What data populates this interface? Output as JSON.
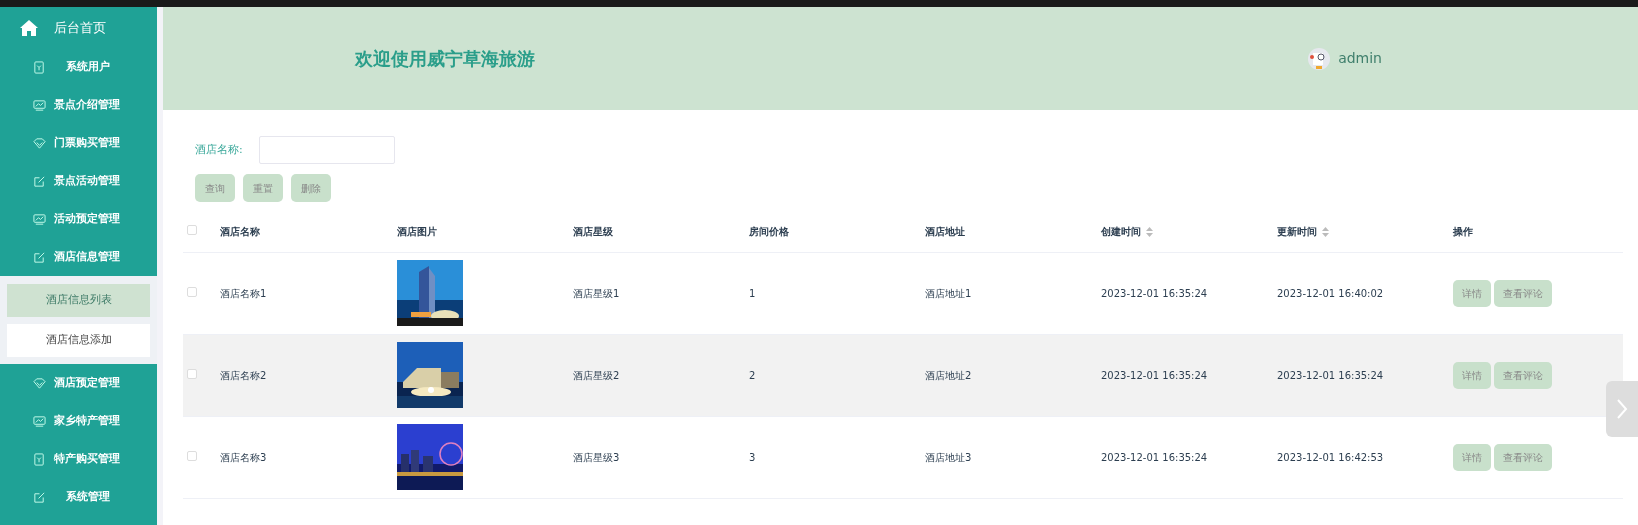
{
  "sidebar": {
    "home": "后台首页",
    "items": [
      {
        "label": "系统用户"
      },
      {
        "label": "景点介绍管理"
      },
      {
        "label": "门票购买管理"
      },
      {
        "label": "景点活动管理"
      },
      {
        "label": "活动预定管理"
      },
      {
        "label": "酒店信息管理",
        "children": [
          {
            "label": "酒店信息列表",
            "selected": true
          },
          {
            "label": "酒店信息添加",
            "selected": false
          }
        ]
      },
      {
        "label": "酒店预定管理"
      },
      {
        "label": "家乡特产管理"
      },
      {
        "label": "特产购买管理"
      },
      {
        "label": "系统管理"
      }
    ]
  },
  "header": {
    "title": "欢迎使用威宁草海旅游",
    "user": "admin"
  },
  "search": {
    "label": "酒店名称:"
  },
  "buttons": [
    "查询",
    "重置",
    "删除"
  ],
  "table": {
    "select_all": false,
    "columns": [
      {
        "label": "酒店名称",
        "sortable": false
      },
      {
        "label": "酒店图片",
        "sortable": false
      },
      {
        "label": "酒店星级",
        "sortable": false
      },
      {
        "label": "房间价格",
        "sortable": false
      },
      {
        "label": "酒店地址",
        "sortable": false
      },
      {
        "label": "创建时间",
        "sortable": true
      },
      {
        "label": "更新时间",
        "sortable": true
      },
      {
        "label": "操作",
        "sortable": false
      }
    ],
    "rows": [
      {
        "checked": false,
        "highlighted": false,
        "name": "酒店名称1",
        "picture": {
          "kind": "picture"
        },
        "stars": "酒店星级1",
        "price": "1",
        "address": "酒店地址1",
        "created": "2023-12-01 16:35:24",
        "updated": "2023-12-01 16:40:02",
        "actions": [
          "详情",
          "查看评论"
        ]
      },
      {
        "checked": false,
        "highlighted": true,
        "name": "酒店名称2",
        "picture": {
          "kind": "picture"
        },
        "stars": "酒店星级2",
        "price": "2",
        "address": "酒店地址2",
        "created": "2023-12-01 16:35:24",
        "updated": "2023-12-01 16:35:24",
        "actions": [
          "详情",
          "查看评论"
        ]
      },
      {
        "checked": false,
        "highlighted": false,
        "name": "酒店名称3",
        "picture": {
          "kind": "picture"
        },
        "stars": "酒店星级3",
        "price": "3",
        "address": "酒店地址3",
        "created": "2023-12-01 16:35:24",
        "updated": "2023-12-01 16:42:53",
        "actions": [
          "详情",
          "查看评论"
        ]
      }
    ]
  }
}
